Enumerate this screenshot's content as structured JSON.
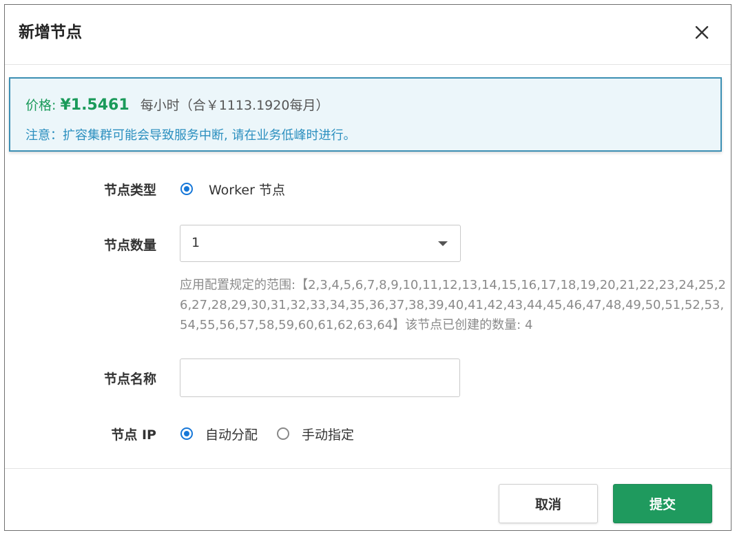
{
  "dialog": {
    "title": "新增节点",
    "close_icon": "close-icon"
  },
  "notice": {
    "price_label": "价格:",
    "price_value": "¥1.5461",
    "price_suffix": "每小时（合￥1113.1920每月）",
    "warning": "注意：扩容集群可能会导致服务中断, 请在业务低峰时进行。"
  },
  "form": {
    "node_type": {
      "label": "节点类型",
      "option": "Worker 节点",
      "selected": true
    },
    "node_count": {
      "label": "节点数量",
      "value": "1",
      "hint": "应用配置规定的范围:【2,3,4,5,6,7,8,9,10,11,12,13,14,15,16,17,18,19,20,21,22,23,24,25,26,27,28,29,30,31,32,33,34,35,36,37,38,39,40,41,42,43,44,45,46,47,48,49,50,51,52,53,54,55,56,57,58,59,60,61,62,63,64】该节点已创建的数量: 4"
    },
    "node_name": {
      "label": "节点名称",
      "value": ""
    },
    "node_ip": {
      "label": "节点 IP",
      "options": [
        "自动分配",
        "手动指定"
      ],
      "selected": "自动分配"
    }
  },
  "footer": {
    "cancel": "取消",
    "submit": "提交"
  },
  "colors": {
    "accent_green": "#1f9a5e",
    "radio_blue": "#1677d8",
    "notice_border": "#3c8fb3",
    "notice_text": "#2b8fbf"
  }
}
